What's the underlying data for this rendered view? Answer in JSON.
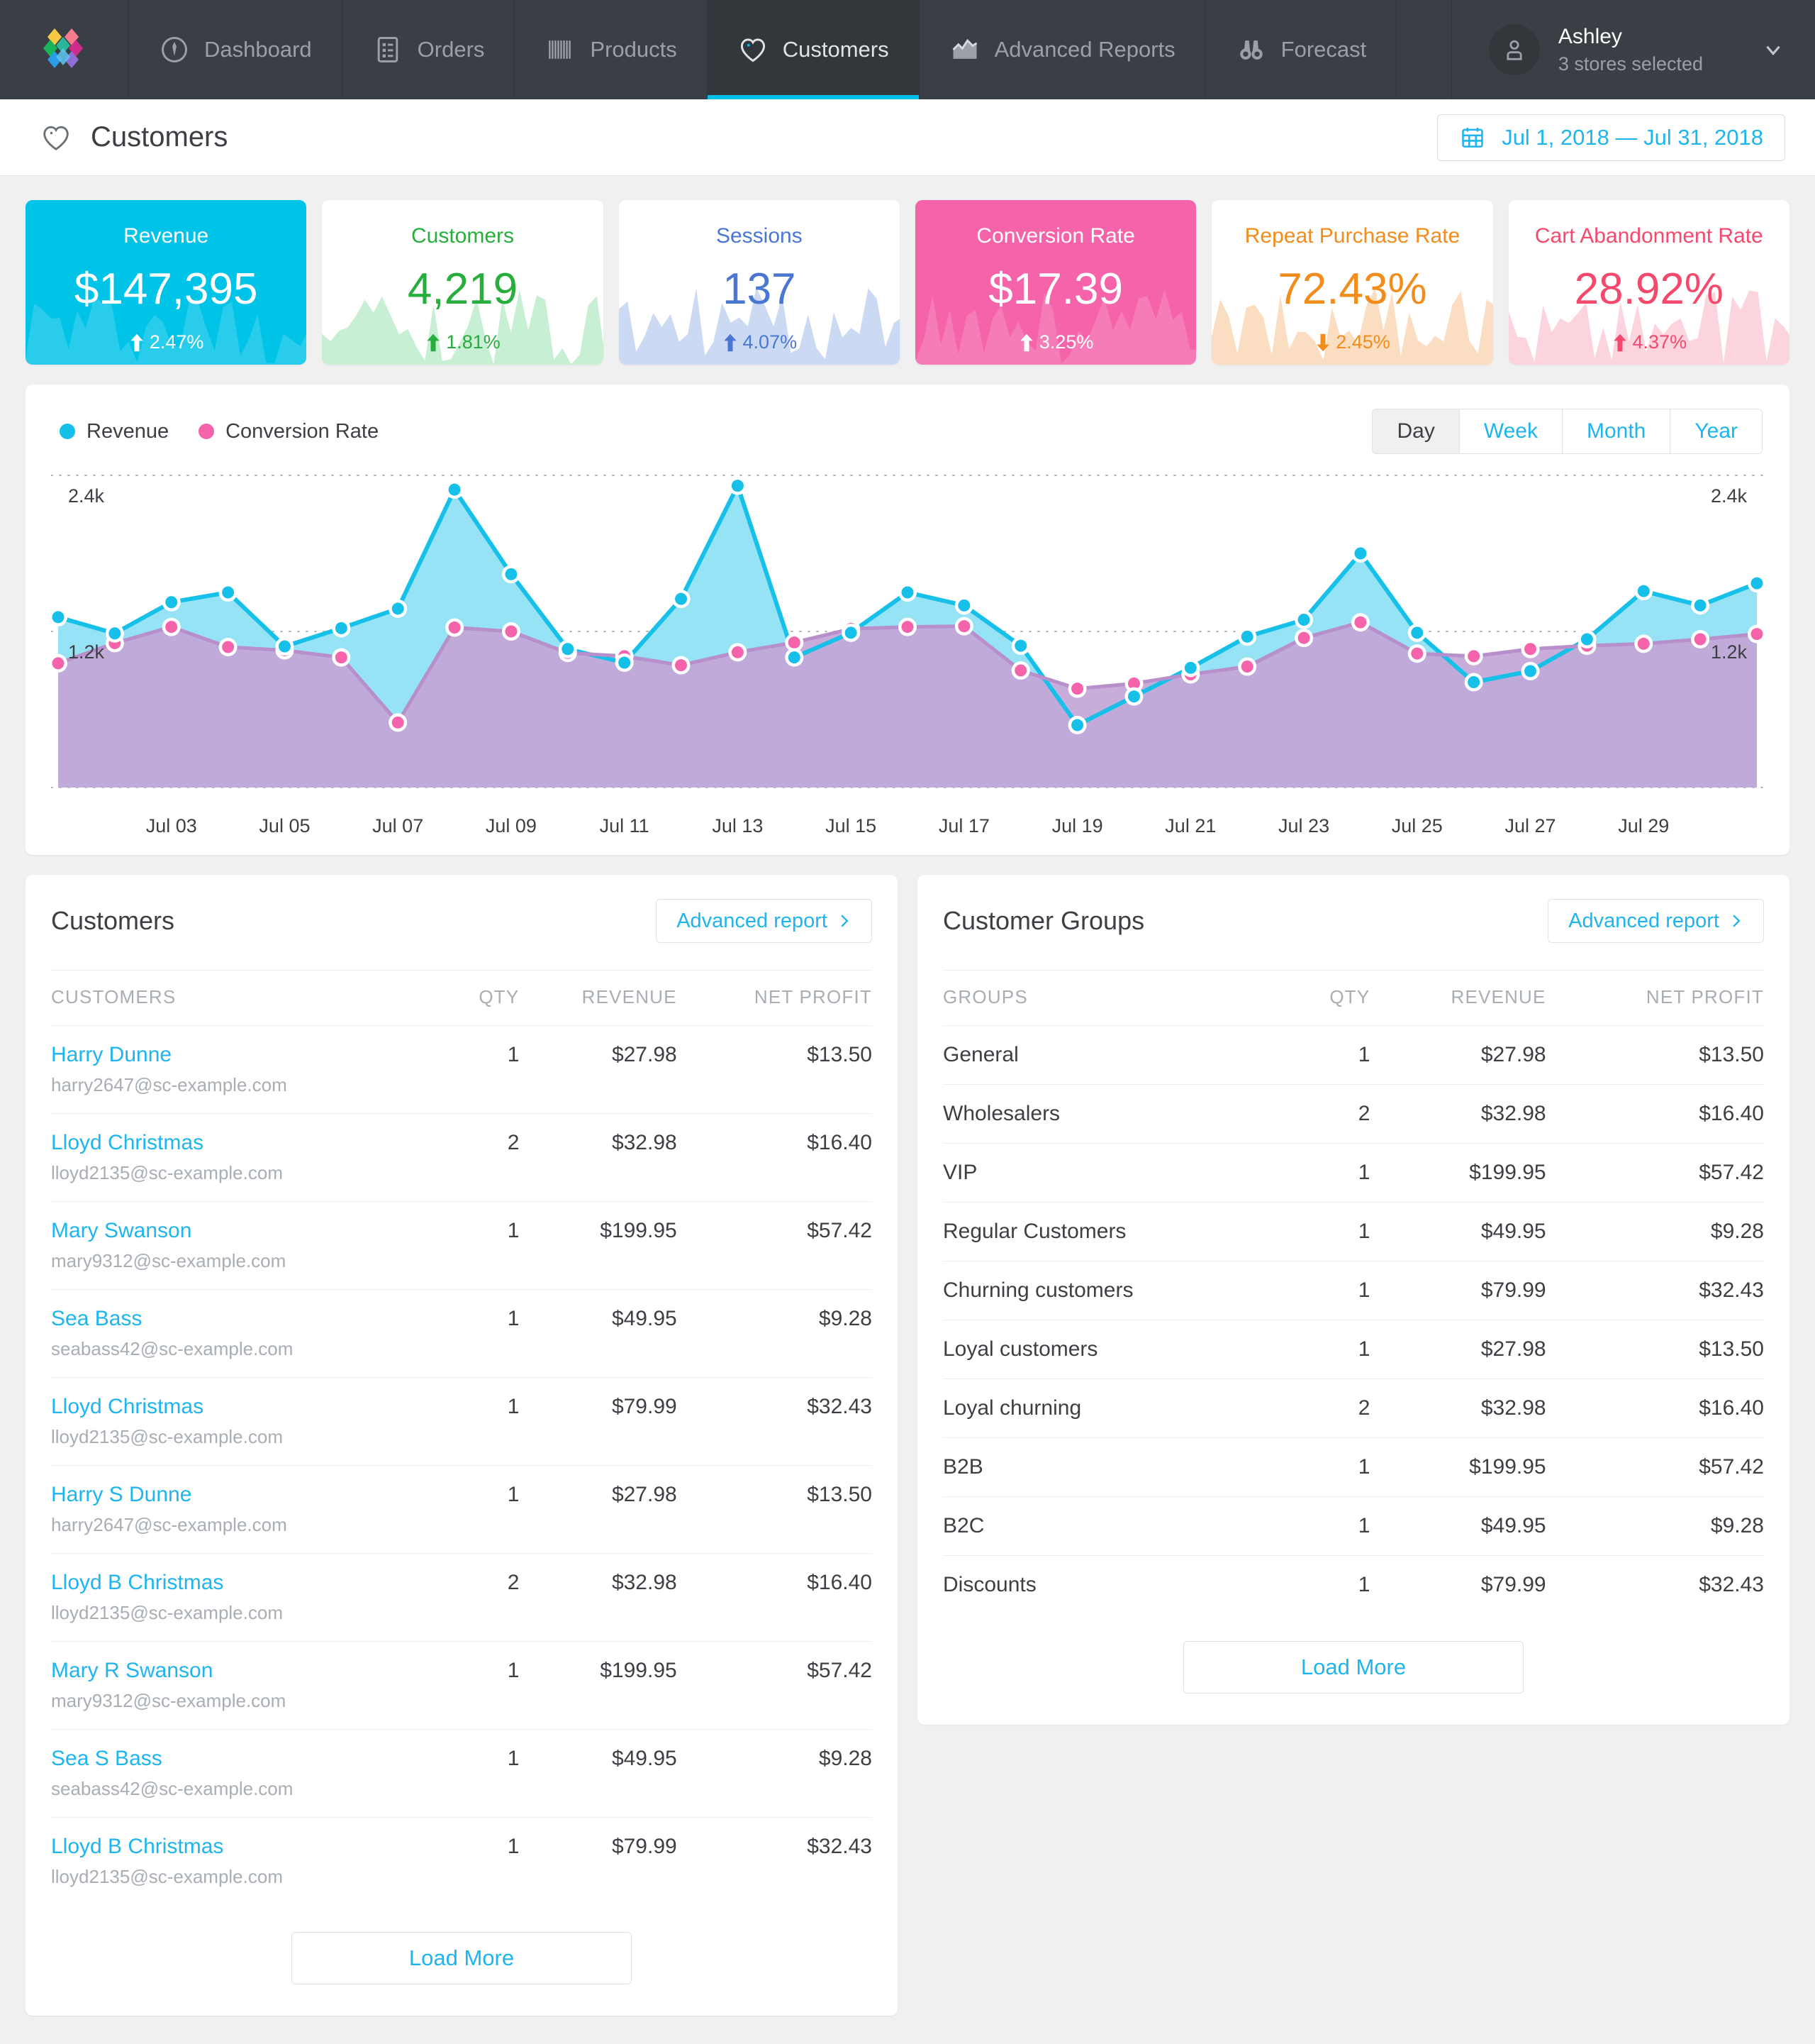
{
  "nav": {
    "brand_icon": "logo-icon",
    "items": [
      {
        "label": "Dashboard",
        "icon": "speedometer-icon",
        "active": false
      },
      {
        "label": "Orders",
        "icon": "list-document-icon",
        "active": false
      },
      {
        "label": "Products",
        "icon": "barcode-icon",
        "active": false
      },
      {
        "label": "Customers",
        "icon": "heart-icon",
        "active": true
      },
      {
        "label": "Advanced Reports",
        "icon": "chart-mountain-icon",
        "active": false
      },
      {
        "label": "Forecast",
        "icon": "binoculars-icon",
        "active": false
      }
    ],
    "user": {
      "name": "Ashley",
      "subtitle": "3 stores selected",
      "avatar_icon": "user-avatar-icon",
      "caret_icon": "chevron-down-icon"
    }
  },
  "page_header": {
    "title": "Customers",
    "icon": "heart-icon",
    "date_range": "Jul 1, 2018 — Jul 31, 2018",
    "date_icon": "calendar-icon"
  },
  "kpis": [
    {
      "title": "Revenue",
      "value": "$147,395",
      "delta": "2.47%",
      "direction": "up",
      "style": "solid",
      "color": "#00c3e8",
      "text_color": "#ffffff",
      "spark_fill": "#ffffff"
    },
    {
      "title": "Customers",
      "value": "4,219",
      "delta": "1.81%",
      "direction": "up",
      "style": "light",
      "color": "#c7efd4",
      "text_color": "#27ae3c",
      "spark_fill": "#c7efd4"
    },
    {
      "title": "Sessions",
      "value": "137",
      "delta": "4.07%",
      "direction": "up",
      "style": "light",
      "color": "#ccd9f2",
      "text_color": "#4a77d4",
      "spark_fill": "#ccd9f2"
    },
    {
      "title": "Conversion Rate",
      "value": "$17.39",
      "delta": "3.25%",
      "direction": "up",
      "style": "solid",
      "color": "#f563ab",
      "text_color": "#ffffff",
      "spark_fill": "#f563ab"
    },
    {
      "title": "Repeat Purchase Rate",
      "value": "72.43%",
      "delta": "2.45%",
      "direction": "down",
      "style": "light",
      "color": "#fbdec2",
      "text_color": "#f28c1b",
      "spark_fill": "#fbdec2"
    },
    {
      "title": "Cart Abandonment Rate",
      "value": "28.92%",
      "delta": "4.37%",
      "direction": "up",
      "style": "light",
      "color": "#fbd4dd",
      "text_color": "#f4496c",
      "spark_fill": "#fbd4dd"
    }
  ],
  "chart_data": {
    "type": "area",
    "title": "",
    "xlabel": "",
    "ylabel": "",
    "grid": true,
    "legend_position": "top-left",
    "ylim": [
      0,
      2400
    ],
    "y_gridlines": [
      1200,
      2400
    ],
    "y_tick_labels_left": [
      "2.4k",
      "1.2k"
    ],
    "y_tick_labels_right": [
      "2.4k",
      "1.2k"
    ],
    "x": [
      "Jul 01",
      "Jul 02",
      "Jul 03",
      "Jul 04",
      "Jul 05",
      "Jul 06",
      "Jul 07",
      "Jul 08",
      "Jul 09",
      "Jul 10",
      "Jul 11",
      "Jul 12",
      "Jul 13",
      "Jul 14",
      "Jul 15",
      "Jul 16",
      "Jul 17",
      "Jul 18",
      "Jul 19",
      "Jul 20",
      "Jul 21",
      "Jul 22",
      "Jul 23",
      "Jul 24",
      "Jul 25",
      "Jul 26",
      "Jul 27",
      "Jul 28",
      "Jul 29",
      "Jul 30",
      "Jul 31"
    ],
    "x_tick_labels": [
      "Jul 03",
      "Jul 05",
      "Jul 07",
      "Jul 09",
      "Jul 11",
      "Jul 13",
      "Jul 15",
      "Jul 17",
      "Jul 19",
      "Jul 21",
      "Jul 23",
      "Jul 25",
      "Jul 27",
      "Jul 29"
    ],
    "series": [
      {
        "name": "Revenue",
        "color": "#16c0e8",
        "fill": "#8fe1f4",
        "values": [
          1310,
          1185,
          1425,
          1500,
          1085,
          1225,
          1375,
          2290,
          1640,
          1065,
          960,
          1450,
          2320,
          1000,
          1190,
          1500,
          1400,
          1090,
          480,
          700,
          920,
          1160,
          1290,
          1800,
          1190,
          810,
          895,
          1140,
          1510,
          1400,
          1570
        ]
      },
      {
        "name": "Conversion Rate",
        "color": "#c89fd4",
        "fill": "#c4a7d8",
        "values": [
          955,
          1110,
          1235,
          1080,
          1055,
          1000,
          500,
          1230,
          1200,
          1035,
          1010,
          940,
          1040,
          1115,
          1220,
          1235,
          1240,
          900,
          760,
          800,
          870,
          930,
          1150,
          1270,
          1030,
          1010,
          1065,
          1090,
          1105,
          1140,
          1180
        ]
      }
    ],
    "range_selector": {
      "options": [
        "Day",
        "Week",
        "Month",
        "Year"
      ],
      "selected": "Day"
    }
  },
  "customers_panel": {
    "title": "Customers",
    "advanced_report_label": "Advanced report",
    "advanced_report_icon": "chevron-right-icon",
    "columns": [
      "CUSTOMERS",
      "QTY",
      "REVENUE",
      "NET PROFIT"
    ],
    "rows": [
      {
        "name": "Harry Dunne",
        "email": "harry2647@sc-example.com",
        "qty": "1",
        "revenue": "$27.98",
        "net_profit": "$13.50"
      },
      {
        "name": "Lloyd Christmas",
        "email": "lloyd2135@sc-example.com",
        "qty": "2",
        "revenue": "$32.98",
        "net_profit": "$16.40"
      },
      {
        "name": "Mary Swanson",
        "email": "mary9312@sc-example.com",
        "qty": "1",
        "revenue": "$199.95",
        "net_profit": "$57.42"
      },
      {
        "name": "Sea Bass",
        "email": "seabass42@sc-example.com",
        "qty": "1",
        "revenue": "$49.95",
        "net_profit": "$9.28"
      },
      {
        "name": "Lloyd Christmas",
        "email": "lloyd2135@sc-example.com",
        "qty": "1",
        "revenue": "$79.99",
        "net_profit": "$32.43"
      },
      {
        "name": "Harry S Dunne",
        "email": "harry2647@sc-example.com",
        "qty": "1",
        "revenue": "$27.98",
        "net_profit": "$13.50"
      },
      {
        "name": "Lloyd B Christmas",
        "email": "lloyd2135@sc-example.com",
        "qty": "2",
        "revenue": "$32.98",
        "net_profit": "$16.40"
      },
      {
        "name": "Mary R Swanson",
        "email": "mary9312@sc-example.com",
        "qty": "1",
        "revenue": "$199.95",
        "net_profit": "$57.42"
      },
      {
        "name": "Sea S Bass",
        "email": "seabass42@sc-example.com",
        "qty": "1",
        "revenue": "$49.95",
        "net_profit": "$9.28"
      },
      {
        "name": "Lloyd B Christmas",
        "email": "lloyd2135@sc-example.com",
        "qty": "1",
        "revenue": "$79.99",
        "net_profit": "$32.43"
      }
    ],
    "load_more_label": "Load More"
  },
  "groups_panel": {
    "title": "Customer Groups",
    "advanced_report_label": "Advanced report",
    "advanced_report_icon": "chevron-right-icon",
    "columns": [
      "GROUPS",
      "QTY",
      "REVENUE",
      "NET PROFIT"
    ],
    "rows": [
      {
        "name": "General",
        "qty": "1",
        "revenue": "$27.98",
        "net_profit": "$13.50"
      },
      {
        "name": "Wholesalers",
        "qty": "2",
        "revenue": "$32.98",
        "net_profit": "$16.40"
      },
      {
        "name": "VIP",
        "qty": "1",
        "revenue": "$199.95",
        "net_profit": "$57.42"
      },
      {
        "name": "Regular Customers",
        "qty": "1",
        "revenue": "$49.95",
        "net_profit": "$9.28"
      },
      {
        "name": "Churning customers",
        "qty": "1",
        "revenue": "$79.99",
        "net_profit": "$32.43"
      },
      {
        "name": "Loyal customers",
        "qty": "1",
        "revenue": "$27.98",
        "net_profit": "$13.50"
      },
      {
        "name": "Loyal churning",
        "qty": "2",
        "revenue": "$32.98",
        "net_profit": "$16.40"
      },
      {
        "name": "B2B",
        "qty": "1",
        "revenue": "$199.95",
        "net_profit": "$57.42"
      },
      {
        "name": "B2C",
        "qty": "1",
        "revenue": "$49.95",
        "net_profit": "$9.28"
      },
      {
        "name": "Discounts",
        "qty": "1",
        "revenue": "$79.99",
        "net_profit": "$32.43"
      }
    ],
    "load_more_label": "Load More"
  }
}
